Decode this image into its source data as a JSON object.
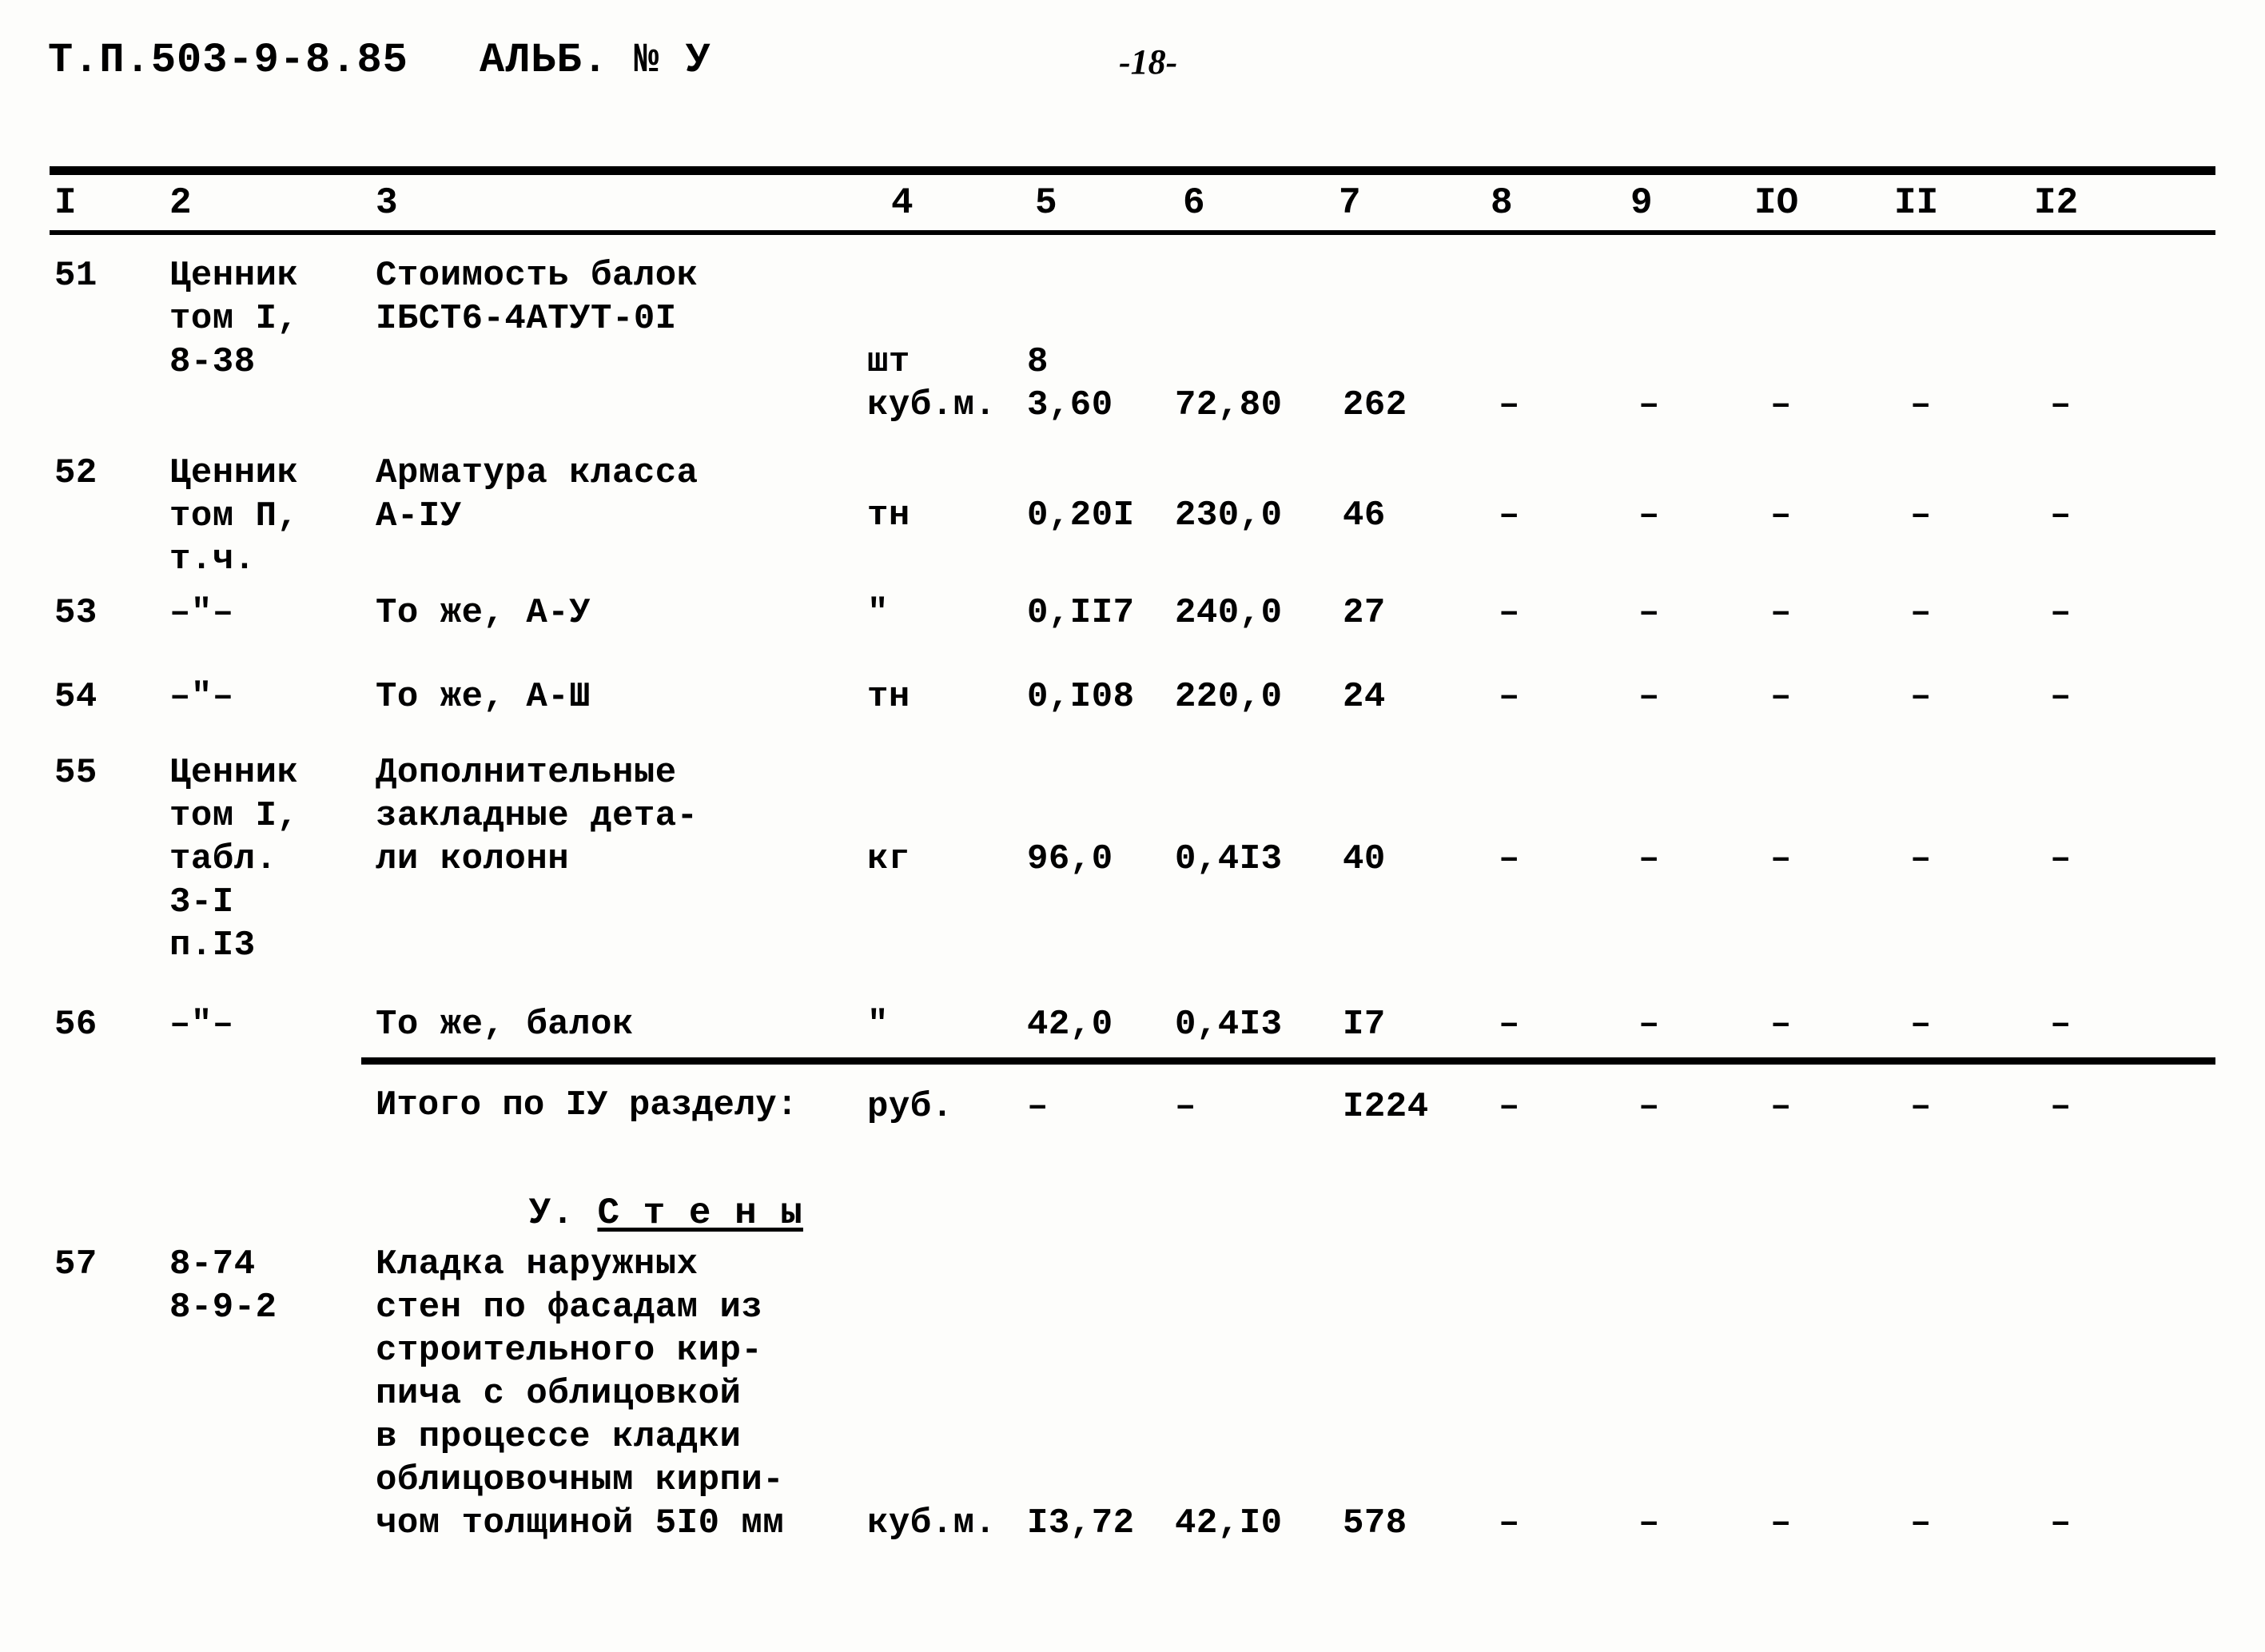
{
  "header": {
    "doc_code": "Т.П.503-9-8.85",
    "album": "АЛЬБ. № У",
    "page_number": "-18-"
  },
  "table": {
    "column_numbers": [
      "I",
      "2",
      "3",
      "4",
      "5",
      "6",
      "7",
      "8",
      "9",
      "IO",
      "II",
      "I2"
    ],
    "dash": "–",
    "rows": [
      {
        "num": "51",
        "source": "Ценник\nтом I,\n8-38",
        "description": "Стоимость балок\nIБСТ6-4АТУТ-0I",
        "unit_a": "шт",
        "qty_a": "8",
        "unit_b": "куб.м.",
        "qty_b": "3,60",
        "price": "72,80",
        "cost": "262",
        "c8": "–",
        "c9": "–",
        "c10": "–",
        "c11": "–",
        "c12": "–"
      },
      {
        "num": "52",
        "source": "Ценник\nтом П,\nт.ч.",
        "description": "Арматура класса\nА-IУ",
        "unit_b": "тн",
        "qty_b": "0,20I",
        "price": "230,0",
        "cost": "46",
        "c8": "–",
        "c9": "–",
        "c10": "–",
        "c11": "–",
        "c12": "–"
      },
      {
        "num": "53",
        "source": "–\"–",
        "description": "То же, А-У",
        "unit_b": "\"",
        "qty_b": "0,II7",
        "price": "240,0",
        "cost": "27",
        "c8": "–",
        "c9": "–",
        "c10": "–",
        "c11": "–",
        "c12": "–"
      },
      {
        "num": "54",
        "source": "–\"–",
        "description": "То же, А-Ш",
        "unit_b": "тн",
        "qty_b": "0,I08",
        "price": "220,0",
        "cost": "24",
        "c8": "–",
        "c9": "–",
        "c10": "–",
        "c11": "–",
        "c12": "–"
      },
      {
        "num": "55",
        "source": "Ценник\nтом I,\nтабл.\n3-I\nп.I3",
        "description": "Дополнительные\nзакладные дета-\nли колонн",
        "unit_b": "кг",
        "qty_b": "96,0",
        "price": "0,4I3",
        "cost": "40",
        "c8": "–",
        "c9": "–",
        "c10": "–",
        "c11": "–",
        "c12": "–"
      },
      {
        "num": "56",
        "source": "–\"–",
        "description": "То же, балок",
        "unit_b": "\"",
        "qty_b": "42,0",
        "price": "0,4I3",
        "cost": "I7",
        "c8": "–",
        "c9": "–",
        "c10": "–",
        "c11": "–",
        "c12": "–"
      },
      {
        "num": "57",
        "source": "8-74\n8-9-2",
        "description": "Кладка наружных\nстен по фасадам из\nстроительного кир-\nпича с облицовкой\nв процессе кладки\nоблицовочным кирпи-\nчом толщиной 5I0 мм",
        "unit_b": "куб.м.",
        "qty_b": "I3,72",
        "price": "42,I0",
        "cost": "578",
        "c8": "–",
        "c9": "–",
        "c10": "–",
        "c11": "–",
        "c12": "–"
      }
    ],
    "total_row": {
      "label": "Итого по IУ разделу:",
      "unit": "руб.",
      "qty": "–",
      "price": "–",
      "cost": "I224",
      "c8": "–",
      "c9": "–",
      "c10": "–",
      "c11": "–",
      "c12": "–"
    },
    "section_heading": {
      "prefix": "У. ",
      "title": "С т е н ы"
    }
  }
}
